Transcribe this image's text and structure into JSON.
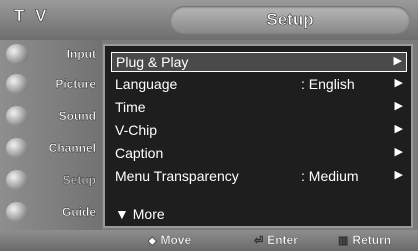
{
  "header": {
    "tv_title": "T V",
    "menu_title": "Setup"
  },
  "sidebar": {
    "items": [
      {
        "label": "Input",
        "icon": "input-icon"
      },
      {
        "label": "Picture",
        "icon": "picture-icon"
      },
      {
        "label": "Sound",
        "icon": "sound-icon"
      },
      {
        "label": "Channel",
        "icon": "channel-icon"
      },
      {
        "label": "Setup",
        "icon": "setup-icon",
        "active": true
      },
      {
        "label": "Guide",
        "icon": "guide-icon"
      }
    ]
  },
  "menu": {
    "rows": [
      {
        "label": "Plug & Play",
        "value": "",
        "arrow": "▶"
      },
      {
        "label": "Language",
        "value": ": English",
        "arrow": "▶"
      },
      {
        "label": "Time",
        "value": "",
        "arrow": "▶"
      },
      {
        "label": "V-Chip",
        "value": "",
        "arrow": "▶"
      },
      {
        "label": "Caption",
        "value": "",
        "arrow": "▶"
      },
      {
        "label": "Menu Transparency",
        "value": ": Medium",
        "arrow": "▶"
      }
    ],
    "more": "▼ More"
  },
  "footer": {
    "move_icon": "◆",
    "move": "Move",
    "enter_icon": "⏎",
    "enter": "Enter",
    "return_icon": "▥",
    "return": "Return"
  }
}
